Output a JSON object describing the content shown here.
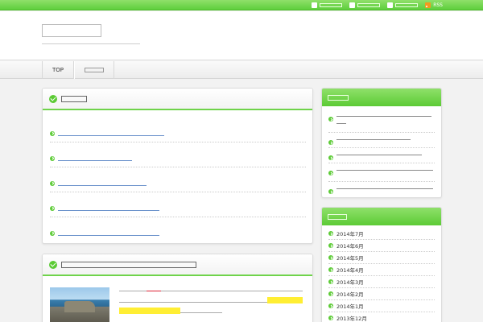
{
  "topbar": {
    "links": [
      {
        "icon": "user-icon",
        "label": ""
      },
      {
        "icon": "document-icon",
        "label": ""
      },
      {
        "icon": "mail-icon",
        "label": ""
      },
      {
        "icon": "rss-icon",
        "label": "RSS"
      }
    ]
  },
  "header": {
    "site_title": "",
    "site_description": ""
  },
  "nav": {
    "items": [
      {
        "label": "TOP"
      },
      {
        "label": ""
      }
    ]
  },
  "new_posts": {
    "title": "",
    "items": [
      {
        "date": "",
        "title": ""
      },
      {
        "date": "",
        "title": ""
      },
      {
        "date": "",
        "title": ""
      },
      {
        "date": "",
        "title": ""
      },
      {
        "date": "",
        "title": ""
      }
    ]
  },
  "article": {
    "title": ""
  },
  "sidebar": {
    "recent_title": "",
    "recent_items": [
      "",
      "",
      "",
      "",
      ""
    ],
    "archive_title": "",
    "archive_items": [
      "2014年7月",
      "2014年6月",
      "2014年5月",
      "2014年4月",
      "2014年3月",
      "2014年2月",
      "2014年1月",
      "2013年12月"
    ]
  },
  "colors": {
    "accent_green": "#5ccb35",
    "link_blue": "#1a56a8",
    "highlight_yellow": "#ffee33",
    "emphasis_red": "#d22233",
    "rss_orange": "#f39a1e"
  }
}
